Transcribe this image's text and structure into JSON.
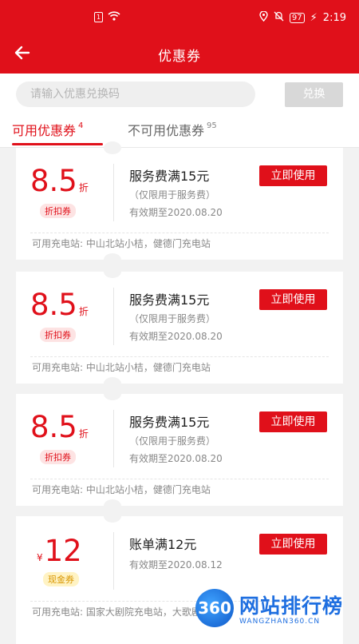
{
  "status_bar": {
    "time": "2:19",
    "battery": "97"
  },
  "header": {
    "title": "优惠券"
  },
  "redeem": {
    "placeholder": "请输入优惠兑换码",
    "button": "兑换"
  },
  "tabs": [
    {
      "label": "可用优惠券",
      "count": "4"
    },
    {
      "label": "不可用优惠券",
      "count": "95"
    }
  ],
  "coupons": [
    {
      "value": "8.5",
      "unit": "折",
      "badge": "折扣券",
      "name": "服务费满15元",
      "limit": "（仅限用于服务费）",
      "expiry": "有效期至2020.08.20",
      "action": "立即使用",
      "stations": "可用充电站: 中山北站小桔，健德门充电站"
    },
    {
      "value": "8.5",
      "unit": "折",
      "badge": "折扣券",
      "name": "服务费满15元",
      "limit": "（仅限用于服务费）",
      "expiry": "有效期至2020.08.20",
      "action": "立即使用",
      "stations": "可用充电站: 中山北站小桔，健德门充电站"
    },
    {
      "value": "8.5",
      "unit": "折",
      "badge": "折扣券",
      "name": "服务费满15元",
      "limit": "（仅限用于服务费）",
      "expiry": "有效期至2020.08.20",
      "action": "立即使用",
      "stations": "可用充电站: 中山北站小桔，健德门充电站"
    },
    {
      "value": "12",
      "currency": "¥",
      "badge": "现金券",
      "name": "账单满12元",
      "expiry": "有效期至2020.08.12",
      "action": "立即使用",
      "stations": "可用充电站: 国家大剧院充电站，大歌剧院"
    }
  ],
  "watermark": {
    "logo": "360",
    "text": "网站排行榜",
    "sub": "WANGZHAN360.CN"
  },
  "colors": {
    "brand": "#e0101a",
    "discount_badge_bg": "#fde3e3",
    "cash_badge_text": "#d89600"
  }
}
